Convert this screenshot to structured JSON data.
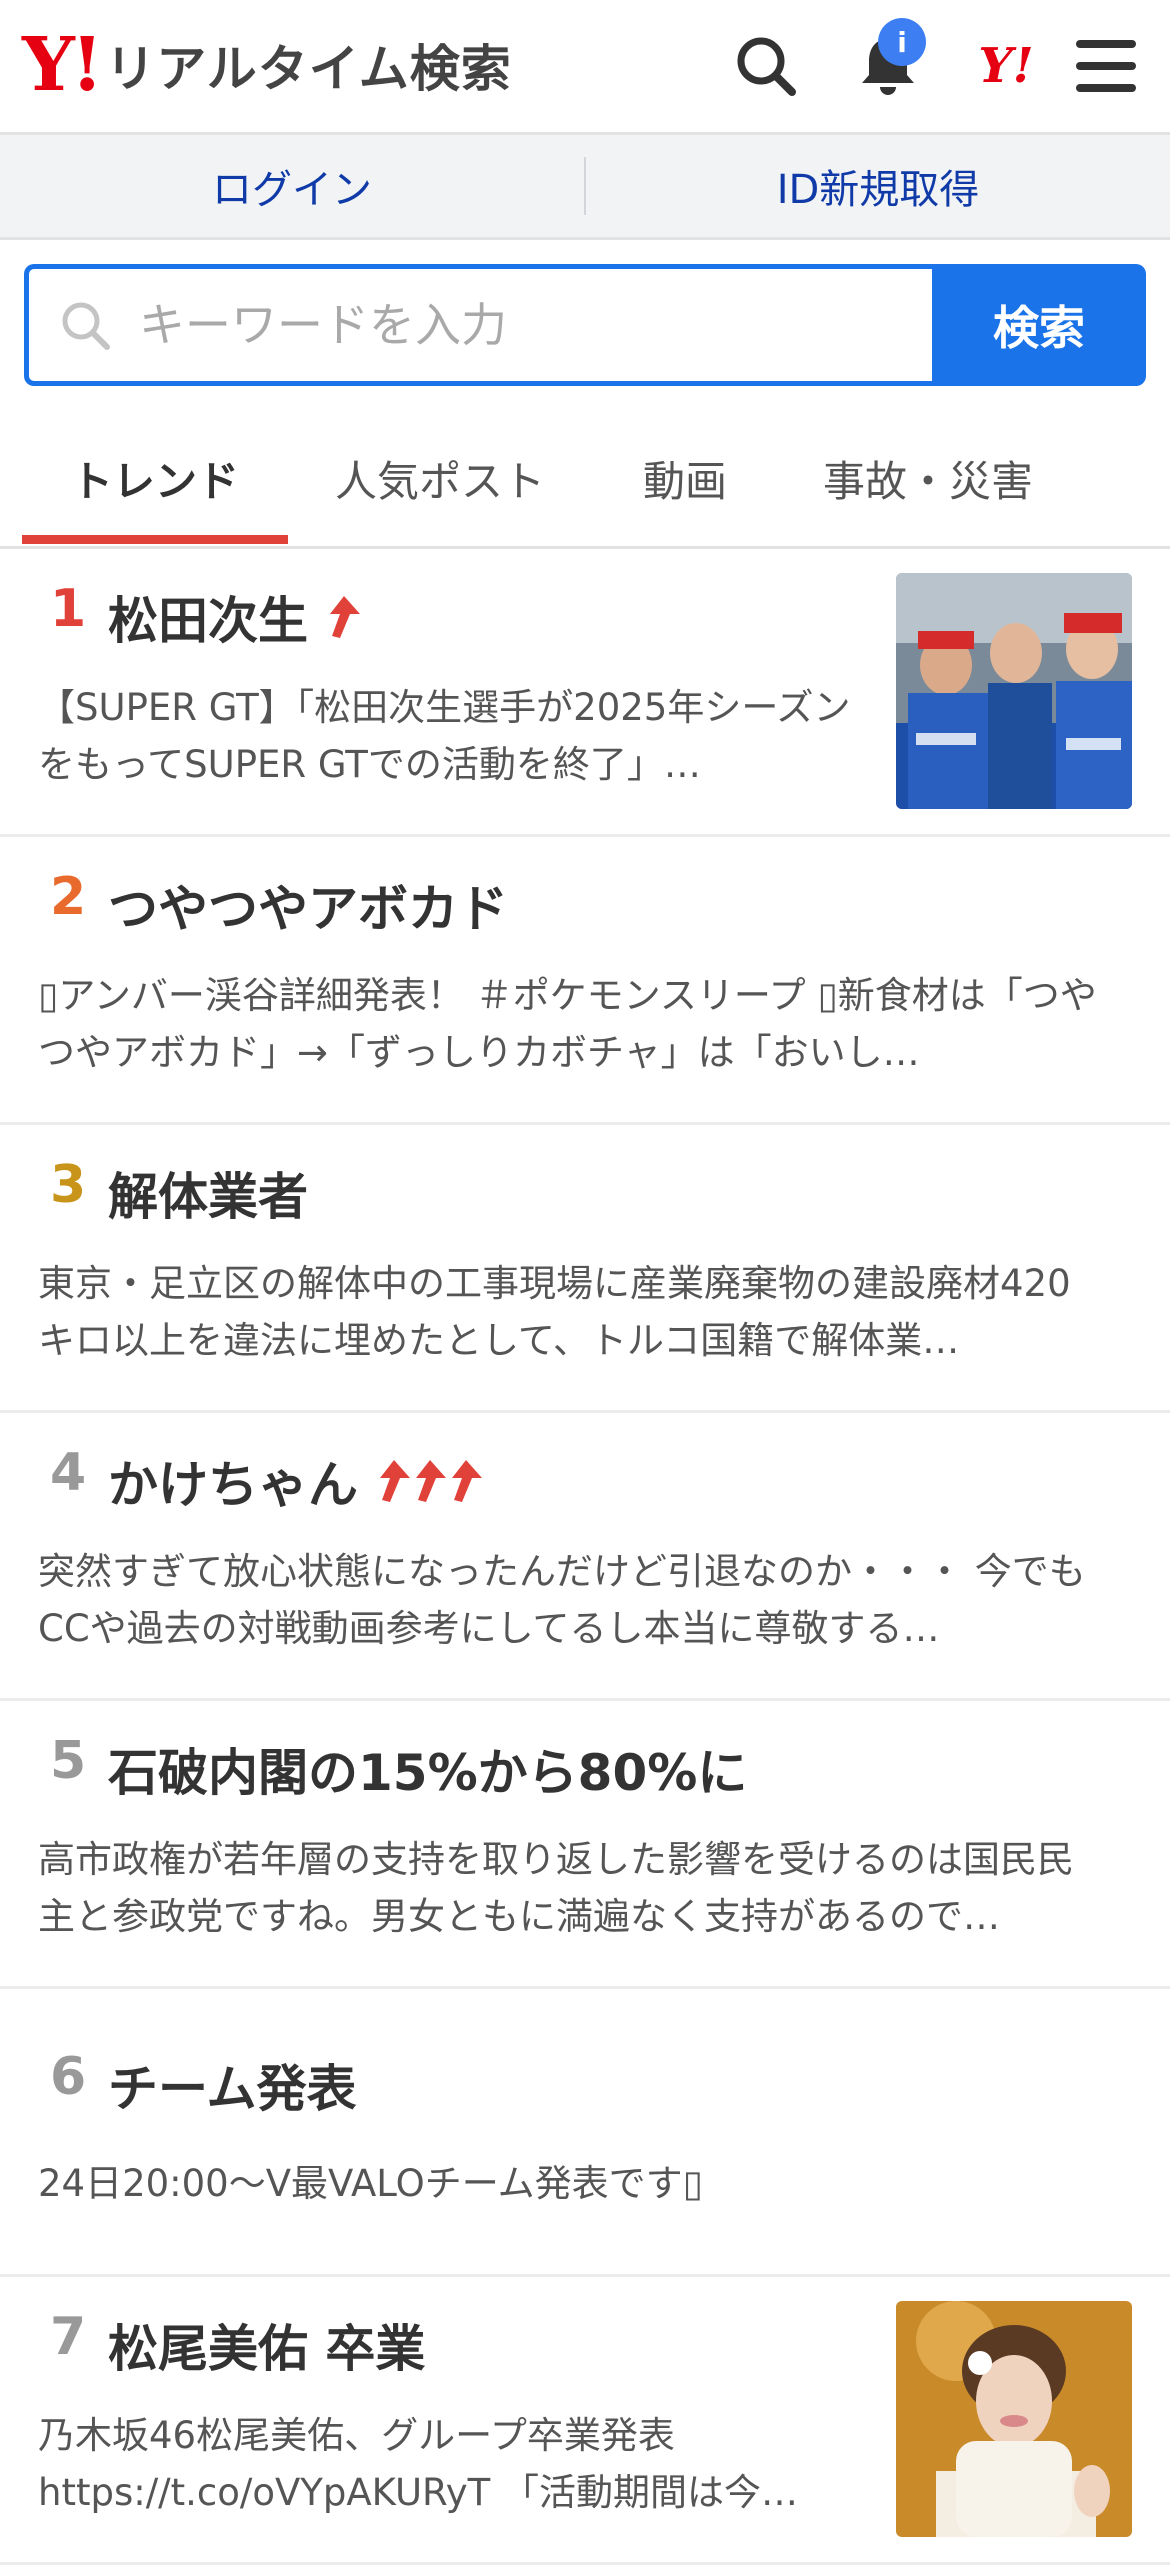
{
  "header": {
    "logo_mark": "Y!",
    "logo_text": "リアルタイム検索",
    "notification_badge": "i",
    "yahoo_mark": "Y!"
  },
  "auth": {
    "login": "ログイン",
    "register": "ID新規取得"
  },
  "search": {
    "placeholder": "キーワードを入力",
    "button": "検索"
  },
  "tabs": [
    {
      "label": "トレンド",
      "active": true
    },
    {
      "label": "人気ポスト"
    },
    {
      "label": "動画"
    },
    {
      "label": "事故・災害"
    }
  ],
  "trends": [
    {
      "rank": "1",
      "term": "松田次生",
      "arrows": 1,
      "desc": "【SUPER GT】「松田次生選手が2025年シーズンをもってSUPER GTでの活動を終了」…",
      "thumb": "racing-photo"
    },
    {
      "rank": "2",
      "term": "つやつやアボカド",
      "arrows": 0,
      "desc": "▯アンバー渓谷詳細発表！ ＃ポケモンスリープ ▯新食材は「つやつやアボカド」→「ずっしりカボチャ」は「おいし…"
    },
    {
      "rank": "3",
      "term": "解体業者",
      "arrows": 0,
      "desc": "東京・足立区の解体中の工事現場に産業廃棄物の建設廃材420キロ以上を違法に埋めたとして、トルコ国籍で解体業…"
    },
    {
      "rank": "4",
      "term": "かけちゃん",
      "arrows": 3,
      "desc": "突然すぎて放心状態になったんだけど引退なのか・・・ 今でもCCや過去の対戦動画参考にしてるし本当に尊敬する…"
    },
    {
      "rank": "5",
      "term": "石破内閣の15%から80%に",
      "arrows": 0,
      "desc": "高市政権が若年層の支持を取り返した影響を受けるのは国民民主と参政党ですね。男女ともに満遍なく支持があるので…"
    },
    {
      "rank": "6",
      "term": "チーム発表",
      "arrows": 0,
      "desc": "24日20:00〜V最VALOチーム発表です▯",
      "single": true
    },
    {
      "rank": "7",
      "term": "松尾美佑 卒業",
      "arrows": 0,
      "desc": "乃木坂46松尾美佑、グループ卒業発表 https://t.co/oVYpAKURyT 「活動期間は今…",
      "thumb": "portrait-photo"
    }
  ],
  "colors": {
    "brand_red": "#e50012",
    "accent_blue": "#1a73e8",
    "link_blue": "#0f3aa8",
    "rank_colors": [
      "#e0423a",
      "#e86a2c",
      "#c8951a",
      "#999999",
      "#999999",
      "#999999",
      "#999999"
    ],
    "arrow_red": "#e0423a"
  }
}
